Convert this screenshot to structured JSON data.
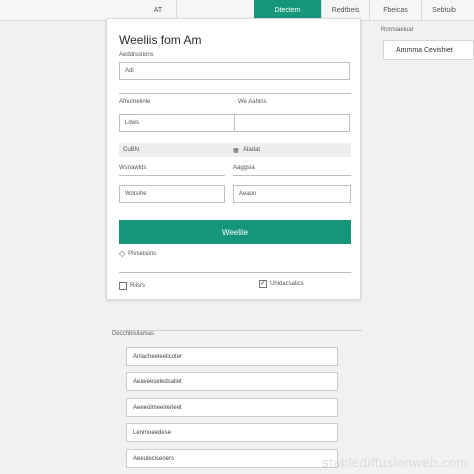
{
  "tabs": [
    {
      "label": "AT"
    },
    {
      "label": ""
    },
    {
      "label": "Dtectem"
    },
    {
      "label": "Redtbeis"
    },
    {
      "label": "Fbeicas"
    },
    {
      "label": "Sebtuib"
    }
  ],
  "side": {
    "label": "Rormiaeiuar",
    "card_text": "Ammma Cevishiet"
  },
  "form": {
    "title": "Weeliis fom Am",
    "address_label": "Aeddrsstions",
    "address_value": "Adi",
    "left_label": "Afnumelinle",
    "right_label": "We Aahins",
    "left_value": "Ldws",
    "right_value": "",
    "grey_left": "CuBN",
    "grey_right": "Aladat",
    "name_label": "Wsnawlds",
    "phone_label": "Aaggsia",
    "name_value": "Wotsihe",
    "phone_value": "Aeaon",
    "submit_label": "Weeliie",
    "consent_label": "Pivseisiins",
    "check_left_label": "Rilsrs",
    "check_right_label": "Uhidacsalics"
  },
  "list": {
    "section_label": "Decchbisilamas",
    "items": [
      {
        "label": "Anlacheeleelicoter"
      },
      {
        "label": "Aeaveeseledsaliet"
      },
      {
        "label": "Aeeeolmeeirerleet"
      },
      {
        "label": "Lenmoeedese"
      },
      {
        "label": "Aeeuleciseriers"
      }
    ]
  },
  "watermark": "stablediffusionweb.com",
  "colors": {
    "accent": "#16967a",
    "background": "#f1f1f1"
  }
}
